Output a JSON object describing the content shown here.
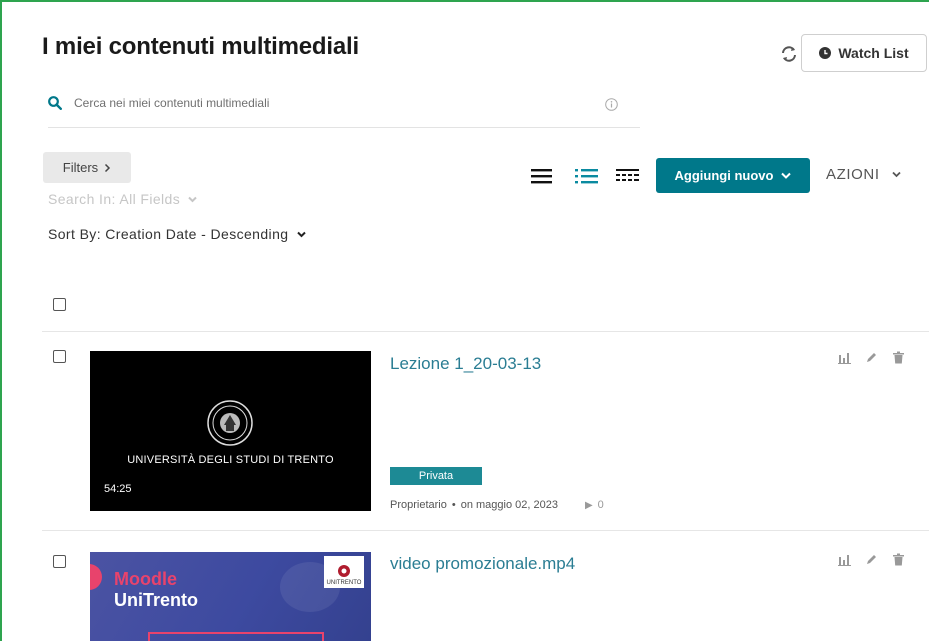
{
  "header": {
    "title": "I miei contenuti multimediali",
    "watch_list_label": "Watch List"
  },
  "search": {
    "placeholder": "Cerca nei miei contenuti multimediali"
  },
  "filters": {
    "filters_label": "Filters",
    "search_in_label": "Search In: All Fields",
    "sort_by_label": "Sort By: Creation Date - Descending"
  },
  "toolbar": {
    "add_new_label": "Aggiungi nuovo",
    "actions_label": "AZIONI"
  },
  "entries": [
    {
      "title": "Lezione 1_20-03-13",
      "thumbnail_text": "UNIVERSITÀ DEGLI STUDI DI TRENTO",
      "duration": "54:25",
      "badge": "Privata",
      "owner": "Proprietario",
      "date": "on maggio 02, 2023",
      "plays": "0"
    },
    {
      "title": "video promozionale.mp4",
      "thumbnail_title_line1": "Moodle",
      "thumbnail_title_line2": "UniTrento",
      "thumbnail_logo_text": "UNITRENTO"
    }
  ],
  "colors": {
    "accent": "#00788a",
    "link": "#2a7d93",
    "frame_border": "#2ea44f"
  },
  "icons": [
    "refresh-icon",
    "clock-icon",
    "search-icon",
    "info-icon",
    "chevron-right-icon",
    "chevron-down-icon",
    "list-view-icon",
    "detailed-view-icon",
    "compact-view-icon",
    "analytics-icon",
    "edit-icon",
    "delete-icon"
  ]
}
